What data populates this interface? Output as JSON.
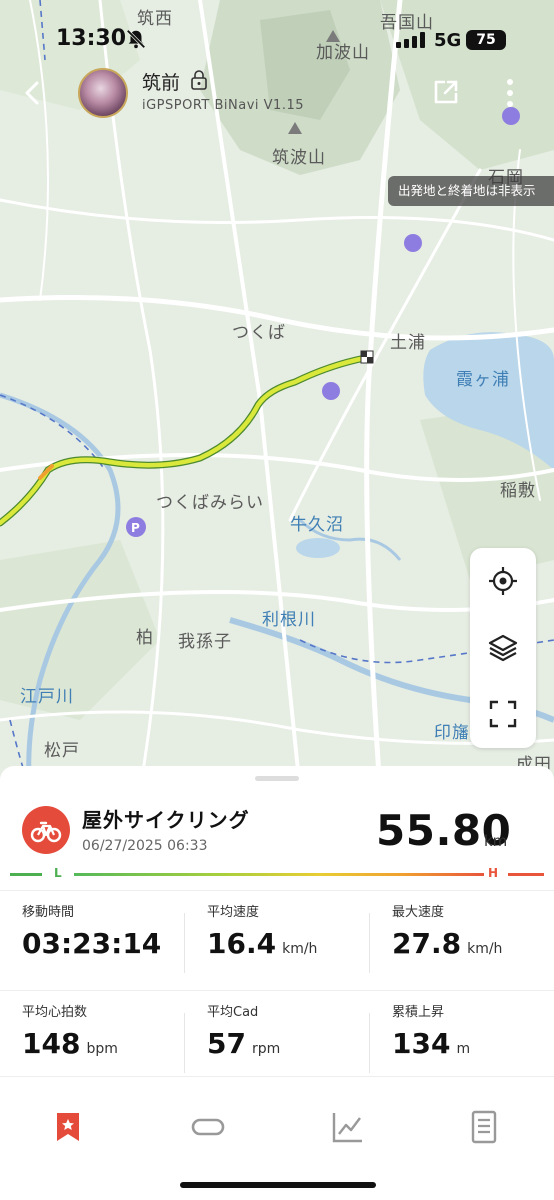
{
  "status_bar": {
    "time": "13:30",
    "network": "5G",
    "battery": "75"
  },
  "header": {
    "name": "筑前",
    "app_version": "iGPSPORT BiNavi V1.15"
  },
  "map": {
    "hide_endpoints_label": "出発地と終着地は非表示",
    "labels": {
      "chikusei": "筑西",
      "agokuni": "吾国山",
      "kabasan": "加波山",
      "tsukubasan": "筑波山",
      "ishioka": "石岡",
      "tsukuba": "つくば",
      "tsuchiura": "土浦",
      "kasumigaura": "霞ヶ浦",
      "tsukubamirai": "つくばみらい",
      "ushikunuma": "牛久沼",
      "inashiki": "稲敷",
      "tonegawa": "利根川",
      "kashiwa": "柏",
      "abiko": "我孫子",
      "edogawa": "江戸川",
      "matsudo": "松戸",
      "inba": "印旛",
      "narita": "成田"
    }
  },
  "activity": {
    "title": "屋外サイクリング",
    "datetime": "06/27/2025 06:33",
    "distance": "55.80",
    "distance_unit": "km",
    "gradient_low": "L",
    "gradient_high": "H"
  },
  "stats": [
    {
      "label": "移動時間",
      "value": "03:23:14",
      "unit": ""
    },
    {
      "label": "平均速度",
      "value": "16.4",
      "unit": "km/h"
    },
    {
      "label": "最大速度",
      "value": "27.8",
      "unit": "km/h"
    },
    {
      "label": "平均心拍数",
      "value": "148",
      "unit": "bpm"
    },
    {
      "label": "平均Cad",
      "value": "57",
      "unit": "rpm"
    },
    {
      "label": "累積上昇",
      "value": "134",
      "unit": "m"
    }
  ],
  "tabs": [
    "summary-tab",
    "laps-tab",
    "charts-tab",
    "details-tab"
  ],
  "colors": {
    "accent": "#e54b3b",
    "route": "#d9e83a",
    "water": "#b9d6ea"
  }
}
